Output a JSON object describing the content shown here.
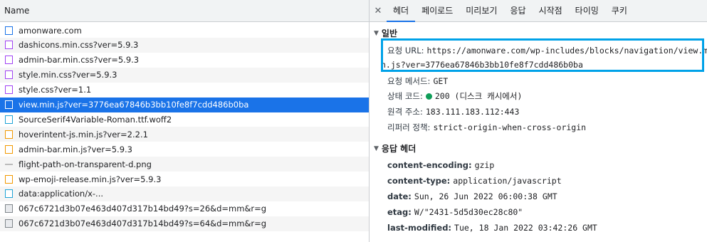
{
  "left": {
    "header": "Name",
    "files": [
      {
        "name": "amonware.com",
        "icon": "document-icon",
        "type": "doc"
      },
      {
        "name": "dashicons.min.css?ver=5.9.3",
        "icon": "css-file-icon",
        "type": "css"
      },
      {
        "name": "admin-bar.min.css?ver=5.9.3",
        "icon": "css-file-icon",
        "type": "css"
      },
      {
        "name": "style.min.css?ver=5.9.3",
        "icon": "css-file-icon",
        "type": "css"
      },
      {
        "name": "style.css?ver=1.1",
        "icon": "css-file-icon",
        "type": "css"
      },
      {
        "name": "view.min.js?ver=3776ea67846b3bb10fe8f7cdd486b0ba",
        "icon": "js-file-icon",
        "type": "js"
      },
      {
        "name": "SourceSerif4Variable-Roman.ttf.woff2",
        "icon": "font-file-icon",
        "type": "font"
      },
      {
        "name": "hoverintent-js.min.js?ver=2.2.1",
        "icon": "js-file-icon",
        "type": "js"
      },
      {
        "name": "admin-bar.min.js?ver=5.9.3",
        "icon": "js-file-icon",
        "type": "js"
      },
      {
        "name": "flight-path-on-transparent-d.png",
        "icon": "image-file-icon",
        "type": "dash"
      },
      {
        "name": "wp-emoji-release.min.js?ver=5.9.3",
        "icon": "js-file-icon",
        "type": "js"
      },
      {
        "name": "data:application/x-...",
        "icon": "font-file-icon",
        "type": "font"
      },
      {
        "name": "067c6721d3b07e463d407d317b14bd49?s=26&d=mm&r=g",
        "icon": "image-file-icon",
        "type": "img"
      },
      {
        "name": "067c6721d3b07e463d407d317b14bd49?s=64&d=mm&r=g",
        "icon": "image-file-icon",
        "type": "img"
      }
    ]
  },
  "tabs": [
    "헤더",
    "페이로드",
    "미리보기",
    "응답",
    "시작점",
    "타이밍",
    "쿠키"
  ],
  "general": {
    "title": "일반",
    "url_key": "요청 URL:",
    "url_line1": "https://amonware.com/wp-includes/blocks/navigation/view.mi",
    "url_line2": "n.js?ver=3776ea67846b3bb10fe8f7cdd486b0ba",
    "method_key": "요청 메서드:",
    "method_val": "GET",
    "status_key": "상태 코드:",
    "status_val": "200  (디스크 캐시에서)",
    "remote_key": "원격 주소:",
    "remote_val": "183.111.183.112:443",
    "referrer_key": "리퍼러 정책:",
    "referrer_val": "strict-origin-when-cross-origin"
  },
  "response_headers": {
    "title": "응답 헤더",
    "items": [
      {
        "k": "content-encoding:",
        "v": "gzip"
      },
      {
        "k": "content-type:",
        "v": "application/javascript"
      },
      {
        "k": "date:",
        "v": "Sun, 26 Jun 2022 06:00:38 GMT"
      },
      {
        "k": "etag:",
        "v": "W/\"2431-5d5d30ec28c80\""
      },
      {
        "k": "last-modified:",
        "v": "Tue, 18 Jan 2022 03:42:26 GMT"
      }
    ]
  },
  "colors": {
    "accent": "#1a73e8",
    "highlight": "#00a2e8",
    "status_ok": "#0f9d58"
  }
}
